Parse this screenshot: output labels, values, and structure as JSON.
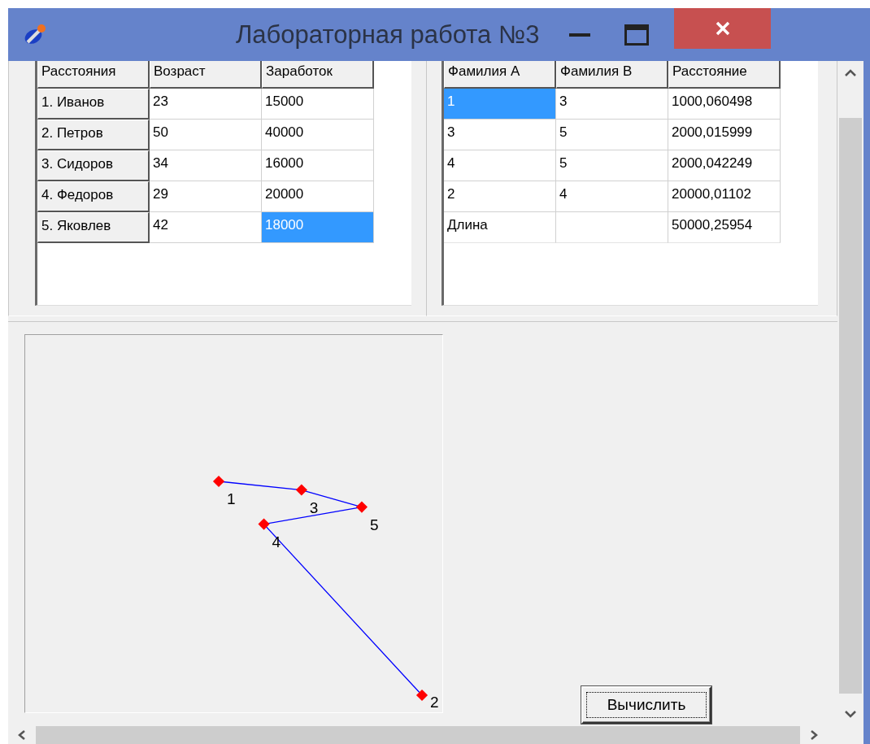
{
  "window": {
    "title": "Лабораторная работа №3"
  },
  "people_table": {
    "columns": [
      "Расстояния",
      "Возраст",
      "Заработок"
    ],
    "rows": [
      {
        "cells": [
          {
            "text": "1. Иванов",
            "selected": false
          },
          {
            "text": "23",
            "selected": false
          },
          {
            "text": "15000",
            "selected": false
          }
        ]
      },
      {
        "cells": [
          {
            "text": "2. Петров",
            "selected": false
          },
          {
            "text": "50",
            "selected": false
          },
          {
            "text": "40000",
            "selected": false
          }
        ]
      },
      {
        "cells": [
          {
            "text": "3. Сидоров",
            "selected": false
          },
          {
            "text": "34",
            "selected": false
          },
          {
            "text": "16000",
            "selected": false
          }
        ]
      },
      {
        "cells": [
          {
            "text": "4. Федоров",
            "selected": false
          },
          {
            "text": "29",
            "selected": false
          },
          {
            "text": "20000",
            "selected": false
          }
        ]
      },
      {
        "cells": [
          {
            "text": "5. Яковлев",
            "selected": false
          },
          {
            "text": "42",
            "selected": false
          },
          {
            "text": "18000",
            "selected": true
          }
        ]
      }
    ]
  },
  "distance_table": {
    "columns": [
      "Фамилия A",
      "Фамилия B",
      "Расстояние"
    ],
    "rows": [
      {
        "kind": "edge",
        "cells": [
          {
            "text": "1",
            "selected": true
          },
          {
            "text": "3",
            "selected": false
          },
          {
            "text": "1000,060498",
            "selected": false
          }
        ]
      },
      {
        "kind": "edge",
        "cells": [
          {
            "text": "3",
            "selected": false
          },
          {
            "text": "5",
            "selected": false
          },
          {
            "text": "2000,015999",
            "selected": false
          }
        ]
      },
      {
        "kind": "edge",
        "cells": [
          {
            "text": "4",
            "selected": false
          },
          {
            "text": "5",
            "selected": false
          },
          {
            "text": "2000,042249",
            "selected": false
          }
        ]
      },
      {
        "kind": "edge",
        "cells": [
          {
            "text": "2",
            "selected": false
          },
          {
            "text": "4",
            "selected": false
          },
          {
            "text": "20000,01102",
            "selected": false
          }
        ]
      },
      {
        "kind": "total",
        "cells": [
          {
            "text": "Длина",
            "selected": false
          },
          {
            "text": "",
            "selected": false
          },
          {
            "text": "50000,25954",
            "selected": false
          }
        ]
      }
    ]
  },
  "graph": {
    "labels": [
      "1",
      "2",
      "3",
      "4",
      "5"
    ]
  },
  "calculate_button": {
    "label": "Вычислить"
  }
}
